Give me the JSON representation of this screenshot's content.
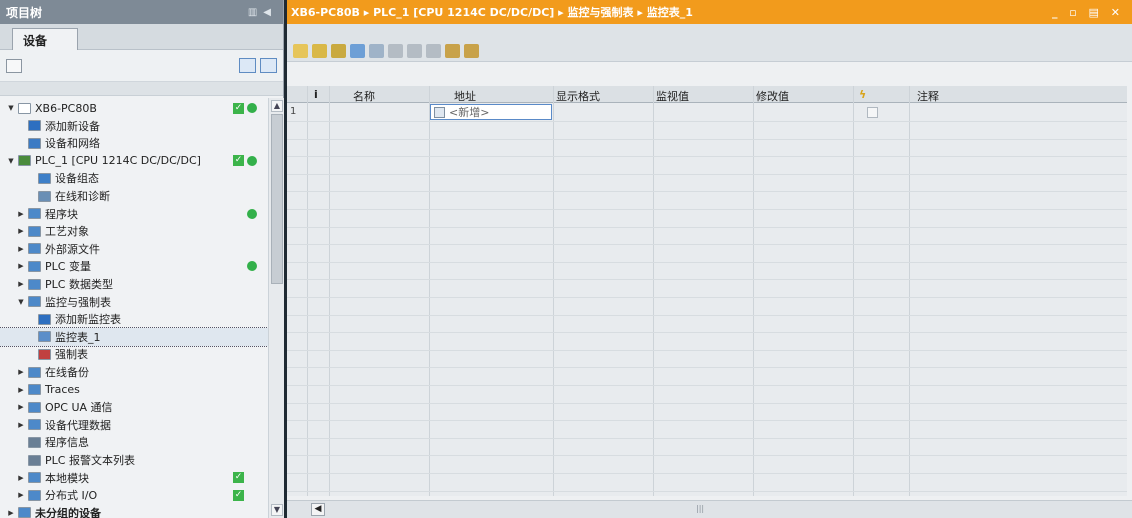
{
  "project_tree": {
    "title": "项目树",
    "tab": "设备"
  },
  "tree_items": [
    {
      "label": "XB6-PC80B",
      "arrow": "▼",
      "icon": "project-icon",
      "color": "#ffffff",
      "checkmark": true,
      "online": true
    },
    {
      "label": "添加新设备",
      "arrow": "",
      "icon": "add-device-icon",
      "color": "#2d6fc0"
    },
    {
      "label": "设备和网络",
      "arrow": "",
      "icon": "network-icon",
      "color": "#3c7bc4"
    },
    {
      "label": "PLC_1 [CPU 1214C DC/DC/DC]",
      "arrow": "▼",
      "icon": "plc-icon",
      "color": "#4a8b3c",
      "checkmark": true,
      "online": true
    },
    {
      "label": "设备组态",
      "arrow": "",
      "icon": "device-config-icon",
      "color": "#3d7fc8"
    },
    {
      "label": "在线和诊断",
      "arrow": "",
      "icon": "diagnostics-icon",
      "color": "#6a8fb5"
    },
    {
      "label": "程序块",
      "arrow": "▶",
      "icon": "folder-icon",
      "color": "#4d89c9",
      "online": true
    },
    {
      "label": "工艺对象",
      "arrow": "▶",
      "icon": "folder-icon",
      "color": "#4d89c9"
    },
    {
      "label": "外部源文件",
      "arrow": "▶",
      "icon": "folder-icon",
      "color": "#4d89c9"
    },
    {
      "label": "PLC 变量",
      "arrow": "▶",
      "icon": "folder-icon",
      "color": "#4d89c9",
      "online": true
    },
    {
      "label": "PLC 数据类型",
      "arrow": "▶",
      "icon": "folder-icon",
      "color": "#4d89c9"
    },
    {
      "label": "监控与强制表",
      "arrow": "▼",
      "icon": "folder-icon",
      "color": "#4d89c9"
    },
    {
      "label": "添加新监控表",
      "arrow": "",
      "icon": "add-watch-table-icon",
      "color": "#2d6fc0"
    },
    {
      "label": "监控表_1",
      "arrow": "",
      "icon": "watch-table-icon",
      "color": "#5b8ec9",
      "selected": true
    },
    {
      "label": "强制表",
      "arrow": "",
      "icon": "force-table-icon",
      "color": "#c04040"
    },
    {
      "label": "在线备份",
      "arrow": "▶",
      "icon": "folder-icon",
      "color": "#4d89c9"
    },
    {
      "label": "Traces",
      "arrow": "▶",
      "icon": "folder-icon",
      "color": "#4d89c9"
    },
    {
      "label": "OPC UA 通信",
      "arrow": "▶",
      "icon": "folder-icon",
      "color": "#4d89c9"
    },
    {
      "label": "设备代理数据",
      "arrow": "▶",
      "icon": "folder-icon",
      "color": "#4d89c9"
    },
    {
      "label": "程序信息",
      "arrow": "",
      "icon": "program-info-icon",
      "color": "#6a7f95"
    },
    {
      "label": "PLC 报警文本列表",
      "arrow": "",
      "icon": "alarm-text-icon",
      "color": "#6a7f95"
    },
    {
      "label": "本地模块",
      "arrow": "▶",
      "icon": "folder-icon",
      "color": "#4d89c9",
      "checkmark": true
    },
    {
      "label": "分布式 I/O",
      "arrow": "▶",
      "icon": "folder-icon",
      "color": "#4d89c9",
      "checkmark": true
    },
    {
      "label": "未分组的设备",
      "arrow": "▶",
      "icon": "folder-icon",
      "color": "#4d89c9"
    }
  ],
  "breadcrumb": "XB6-PC80B ▸ PLC_1 [CPU 1214C DC/DC/DC] ▸ 监控与强制表 ▸ 监控表_1",
  "table": {
    "headers": [
      "i",
      "名称",
      "地址",
      "显示格式",
      "监视值",
      "修改值",
      "注释"
    ],
    "row_number": "1",
    "address_placeholder": "<新增>"
  },
  "colors": {
    "accent": "#f29b1c",
    "status_green": "#33b04a"
  }
}
